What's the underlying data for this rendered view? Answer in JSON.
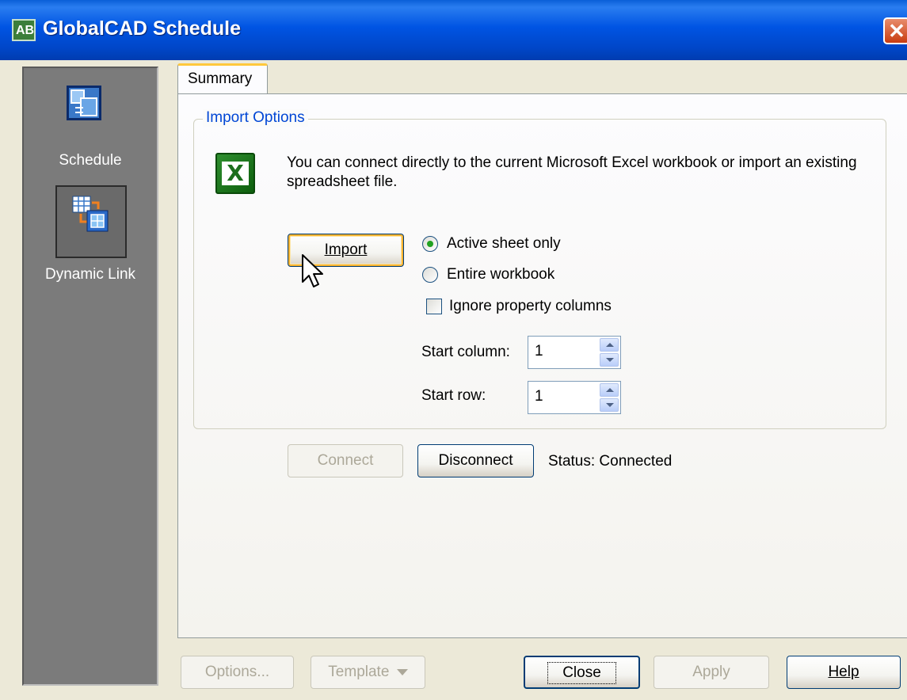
{
  "window": {
    "title": "GlobalCAD Schedule",
    "close_glyph": "✕"
  },
  "sidebar": {
    "items": [
      {
        "label": "Schedule",
        "icon": "schedule-icon",
        "selected": false
      },
      {
        "label": "Dynamic Link",
        "icon": "dynamic-link-icon",
        "selected": true
      }
    ]
  },
  "tabs": [
    {
      "label": "Summary",
      "active": true
    }
  ],
  "import_options": {
    "group_title": "Import Options",
    "description": "You can connect directly to the current Microsoft Excel workbook or import an existing spreadsheet file.",
    "import_button": "Import",
    "radio_active_sheet": "Active sheet only",
    "radio_entire_workbook": "Entire workbook",
    "selected_radio": "Active sheet only",
    "checkbox_ignore": "Ignore property columns",
    "checkbox_ignore_checked": false,
    "start_column_label": "Start column:",
    "start_column_value": "1",
    "start_row_label": "Start row:",
    "start_row_value": "1"
  },
  "connection": {
    "connect_button": "Connect",
    "disconnect_button": "Disconnect",
    "status": "Status: Connected"
  },
  "footer": {
    "options_button": "Options...",
    "template_button": "Template",
    "close_button": "Close",
    "apply_button": "Apply",
    "help_button": "Help"
  },
  "colors": {
    "titlebar": "#0054e3",
    "sidebar": "#7b7b7b",
    "group_title": "#0046d5",
    "tab_highlight": "#ffc83c",
    "radio_dot": "#21a121",
    "excel_green": "#1d6e1d"
  }
}
